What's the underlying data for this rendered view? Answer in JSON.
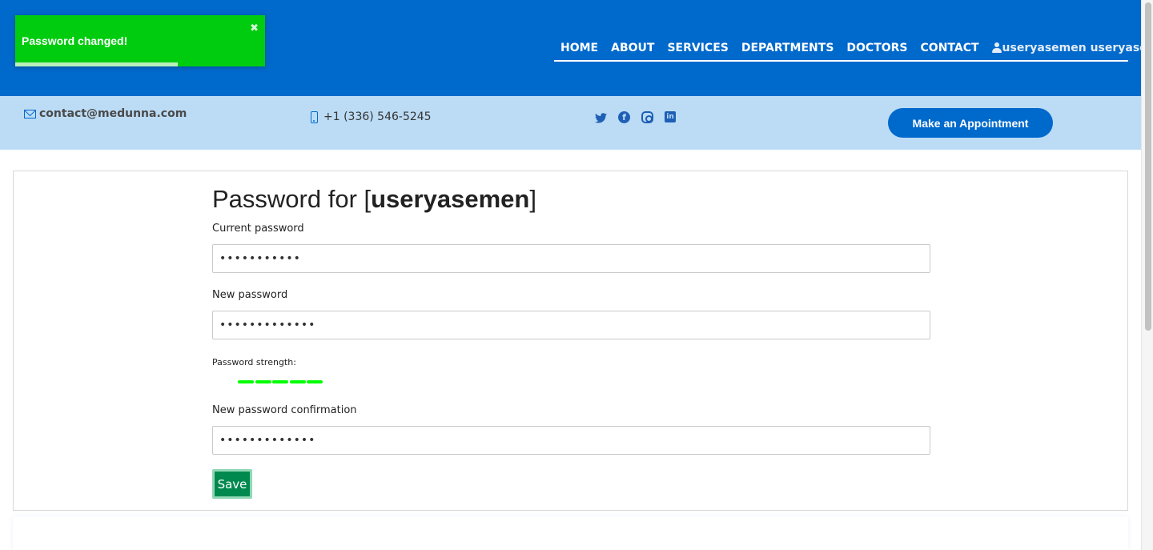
{
  "nav": {
    "items": [
      "HOME",
      "ABOUT",
      "SERVICES",
      "DEPARTMENTS",
      "DOCTORS",
      "CONTACT"
    ],
    "user_label": "useryasemen useryasemen",
    "caret": "▾"
  },
  "toast": {
    "message": "Password changed!",
    "close": "✖",
    "progress_fraction": 0.65
  },
  "info": {
    "email": "contact@medunna.com",
    "phone": "+1 (336) 546-5245",
    "socials": [
      "twitter-icon",
      "facebook-icon",
      "instagram-icon",
      "linkedin-icon"
    ],
    "appointment_label": "Make an Appointment"
  },
  "form": {
    "title_prefix": "Password for [",
    "title_user": "useryasemen",
    "title_suffix": "]",
    "current_label": "Current password",
    "current_value": "•••••••••••",
    "new_label": "New password",
    "new_value": "•••••••••••••",
    "strength_label": "Password strength:",
    "strength_segments_filled": 5,
    "confirm_label": "New password confirmation",
    "confirm_value": "•••••••••••••",
    "save_label": "Save"
  },
  "colors": {
    "brand": "#0069cc",
    "toast": "#00cc0f",
    "save": "#00894f",
    "strength": "#00ff00"
  }
}
